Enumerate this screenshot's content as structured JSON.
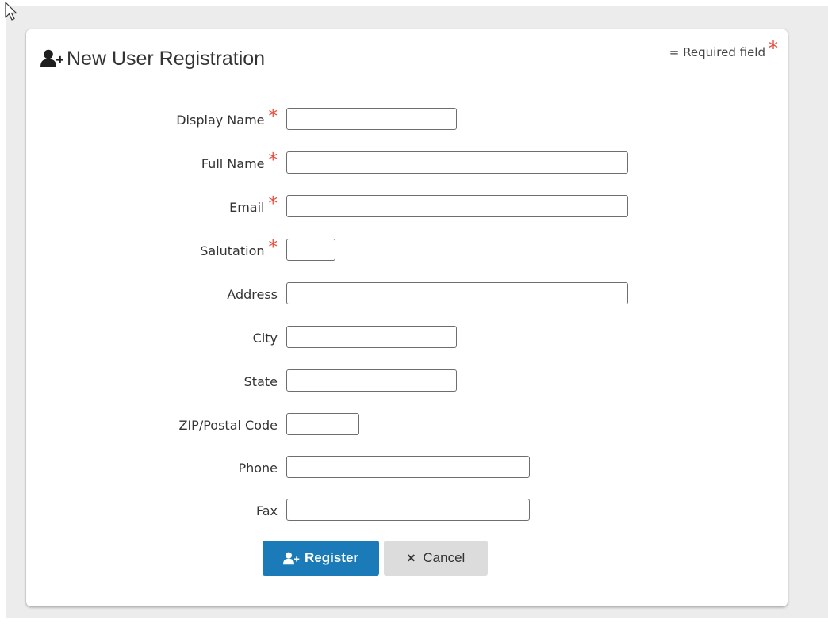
{
  "header": {
    "title": "New User Registration",
    "required_note": "= Required field",
    "required_marker": "*"
  },
  "fields": [
    {
      "label": "Display Name",
      "required": true,
      "value": ""
    },
    {
      "label": "Full Name",
      "required": true,
      "value": ""
    },
    {
      "label": "Email",
      "required": true,
      "value": ""
    },
    {
      "label": "Salutation",
      "required": true,
      "value": ""
    },
    {
      "label": "Address",
      "required": false,
      "value": ""
    },
    {
      "label": "City",
      "required": false,
      "value": ""
    },
    {
      "label": "State",
      "required": false,
      "value": ""
    },
    {
      "label": "ZIP/Postal Code",
      "required": false,
      "value": ""
    },
    {
      "label": "Phone",
      "required": false,
      "value": ""
    },
    {
      "label": "Fax",
      "required": false,
      "value": ""
    }
  ],
  "actions": {
    "register_label": "Register",
    "cancel_label": "Cancel"
  },
  "icons": {
    "title": "user-plus-icon",
    "register": "user-plus-icon",
    "cancel": "close-icon",
    "cursor": "mouse-pointer-icon"
  },
  "colors": {
    "required_star": "#e74c3c",
    "primary_button": "#1a7bb8",
    "secondary_button": "#dcdcdc",
    "page_background": "#ececec"
  }
}
